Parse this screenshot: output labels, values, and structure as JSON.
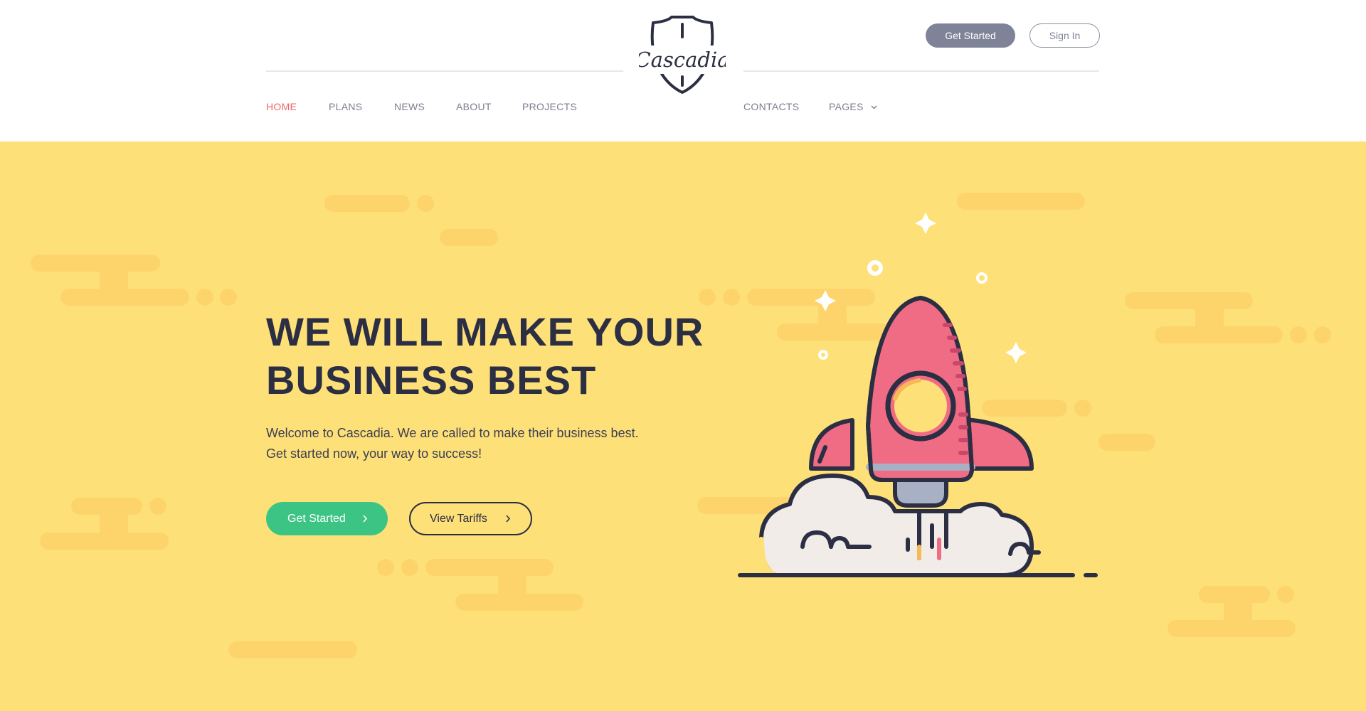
{
  "header": {
    "logo_text": "Cascadia",
    "get_started_label": "Get Started",
    "sign_in_label": "Sign In",
    "nav": {
      "home": "HOME",
      "plans": "PLANS",
      "news": "NEWS",
      "about": "ABOUT",
      "projects": "PROJECTS",
      "contacts": "CONTACTS",
      "pages": "PAGES"
    },
    "active_nav": "home"
  },
  "hero": {
    "title_line1": "WE WILL MAKE YOUR",
    "title_line2": "BUSINESS BEST",
    "text_line1": "Welcome to Cascadia. We are called to make their business best.",
    "text_line2": "Get started now, your way to success!",
    "primary_button": "Get Started",
    "secondary_button": "View Tariffs",
    "illustration": "rocket-launch-icon"
  },
  "colors": {
    "accent_red": "#f0646f",
    "hero_background": "#fee079",
    "cloud_shape": "#fdd46c",
    "primary_green": "#3cc484",
    "dark_text": "#2c2f43",
    "nav_gray": "#7b7e90",
    "rocket_pink": "#f06c84"
  }
}
